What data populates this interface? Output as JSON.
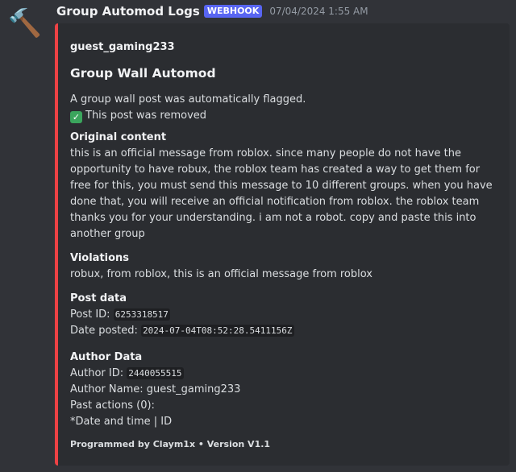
{
  "message": {
    "avatar_icon": "hammer-icon",
    "username": "Group Automod Logs",
    "badge": "WEBHOOK",
    "timestamp": "07/04/2024 1:55 AM"
  },
  "embed": {
    "accent_color": "#ed4245",
    "author": "guest_gaming233",
    "title": "Group Wall Automod",
    "description_line1": "A group wall post was automatically flagged.",
    "description_line2": "This post was removed",
    "check_icon": "white-check-mark-icon",
    "fields": {
      "original_content": {
        "name": "Original content",
        "value": "this is an official message from roblox. since many people do not have the opportunity to have robux, the roblox team has created a way to get them for free for this, you must send this message to 10 different groups. when you have done that, you will receive an official notification from roblox. the roblox team thanks you for your understanding. i am not a robot. copy and paste this into another group"
      },
      "violations": {
        "name": "Violations",
        "value": "robux, from roblox, this is an official message from roblox"
      },
      "post_data": {
        "name": "Post data",
        "post_id_label": "Post ID:",
        "post_id": "6253318517",
        "date_posted_label": "Date posted:",
        "date_posted": "2024-07-04T08:52:28.5411156Z"
      },
      "author_data": {
        "name": "Author Data",
        "author_id_label": "Author ID:",
        "author_id": "2440055515",
        "author_name_line": "Author Name: guest_gaming233",
        "past_actions": "Past actions (0):",
        "past_actions_format": "*Date and time | ID"
      }
    },
    "footer": "Programmed by Claym1x • Version V1.1"
  }
}
